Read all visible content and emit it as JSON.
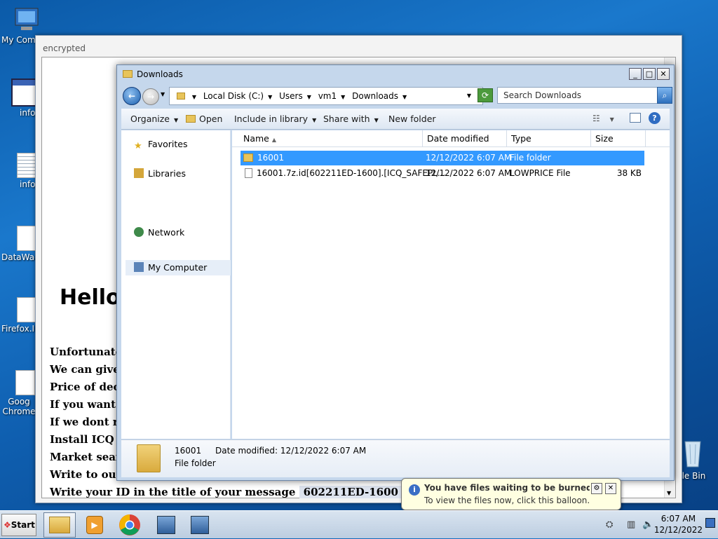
{
  "desktop": {
    "icons": [
      {
        "label": "My Comp",
        "name": "desktop-icon-my-computer"
      },
      {
        "label": "info",
        "name": "desktop-icon-info-hta"
      },
      {
        "label": "info",
        "name": "desktop-icon-info-txt"
      },
      {
        "label": "DataWag",
        "name": "desktop-icon-datawag"
      },
      {
        "label": "Firefox.In",
        "name": "desktop-icon-firefox"
      },
      {
        "label": "Goog Chrome",
        "name": "desktop-icon-chrome"
      },
      {
        "label": "cle Bin",
        "name": "desktop-icon-recycle-bin"
      }
    ]
  },
  "ransom_window": {
    "title": "encrypted",
    "hello": "Hello,",
    "lines": [
      "Unfortunatel",
      "We can give",
      "Price of decr",
      "If you want t",
      "If we dont re",
      "Install ICQ s",
      "Market searc",
      "Write to our"
    ],
    "id_line_label": "Write your ID in the title of your message",
    "id_value": "602211ED-1600"
  },
  "explorer": {
    "title": "Downloads",
    "breadcrumb": [
      "Local Disk (C:)",
      "Users",
      "vm1",
      "Downloads"
    ],
    "search_placeholder": "Search Downloads",
    "toolbar": {
      "organize": "Organize",
      "open": "Open",
      "include": "Include in library",
      "share": "Share with",
      "new_folder": "New folder"
    },
    "sidebar": [
      "Favorites",
      "Libraries",
      "My Computer",
      "Network"
    ],
    "columns": [
      "Name",
      "Date modified",
      "Type",
      "Size"
    ],
    "rows": [
      {
        "name": "16001",
        "date": "12/12/2022 6:07 AM",
        "type": "File folder",
        "size": ""
      },
      {
        "name": "16001.7z.id[602211ED-1600].[ICQ_SAFEPL...",
        "date": "12/12/2022 6:07 AM",
        "type": "LOWPRICE File",
        "size": "38 KB"
      }
    ],
    "details": {
      "name": "16001",
      "date_label": "Date modified:",
      "date": "12/12/2022 6:07 AM",
      "type": "File folder"
    }
  },
  "balloon": {
    "title": "You have files waiting to be burned to disc",
    "text": "To view the files now, click this balloon."
  },
  "taskbar": {
    "start": "Start",
    "time": "6:07 AM",
    "date": "12/12/2022"
  }
}
